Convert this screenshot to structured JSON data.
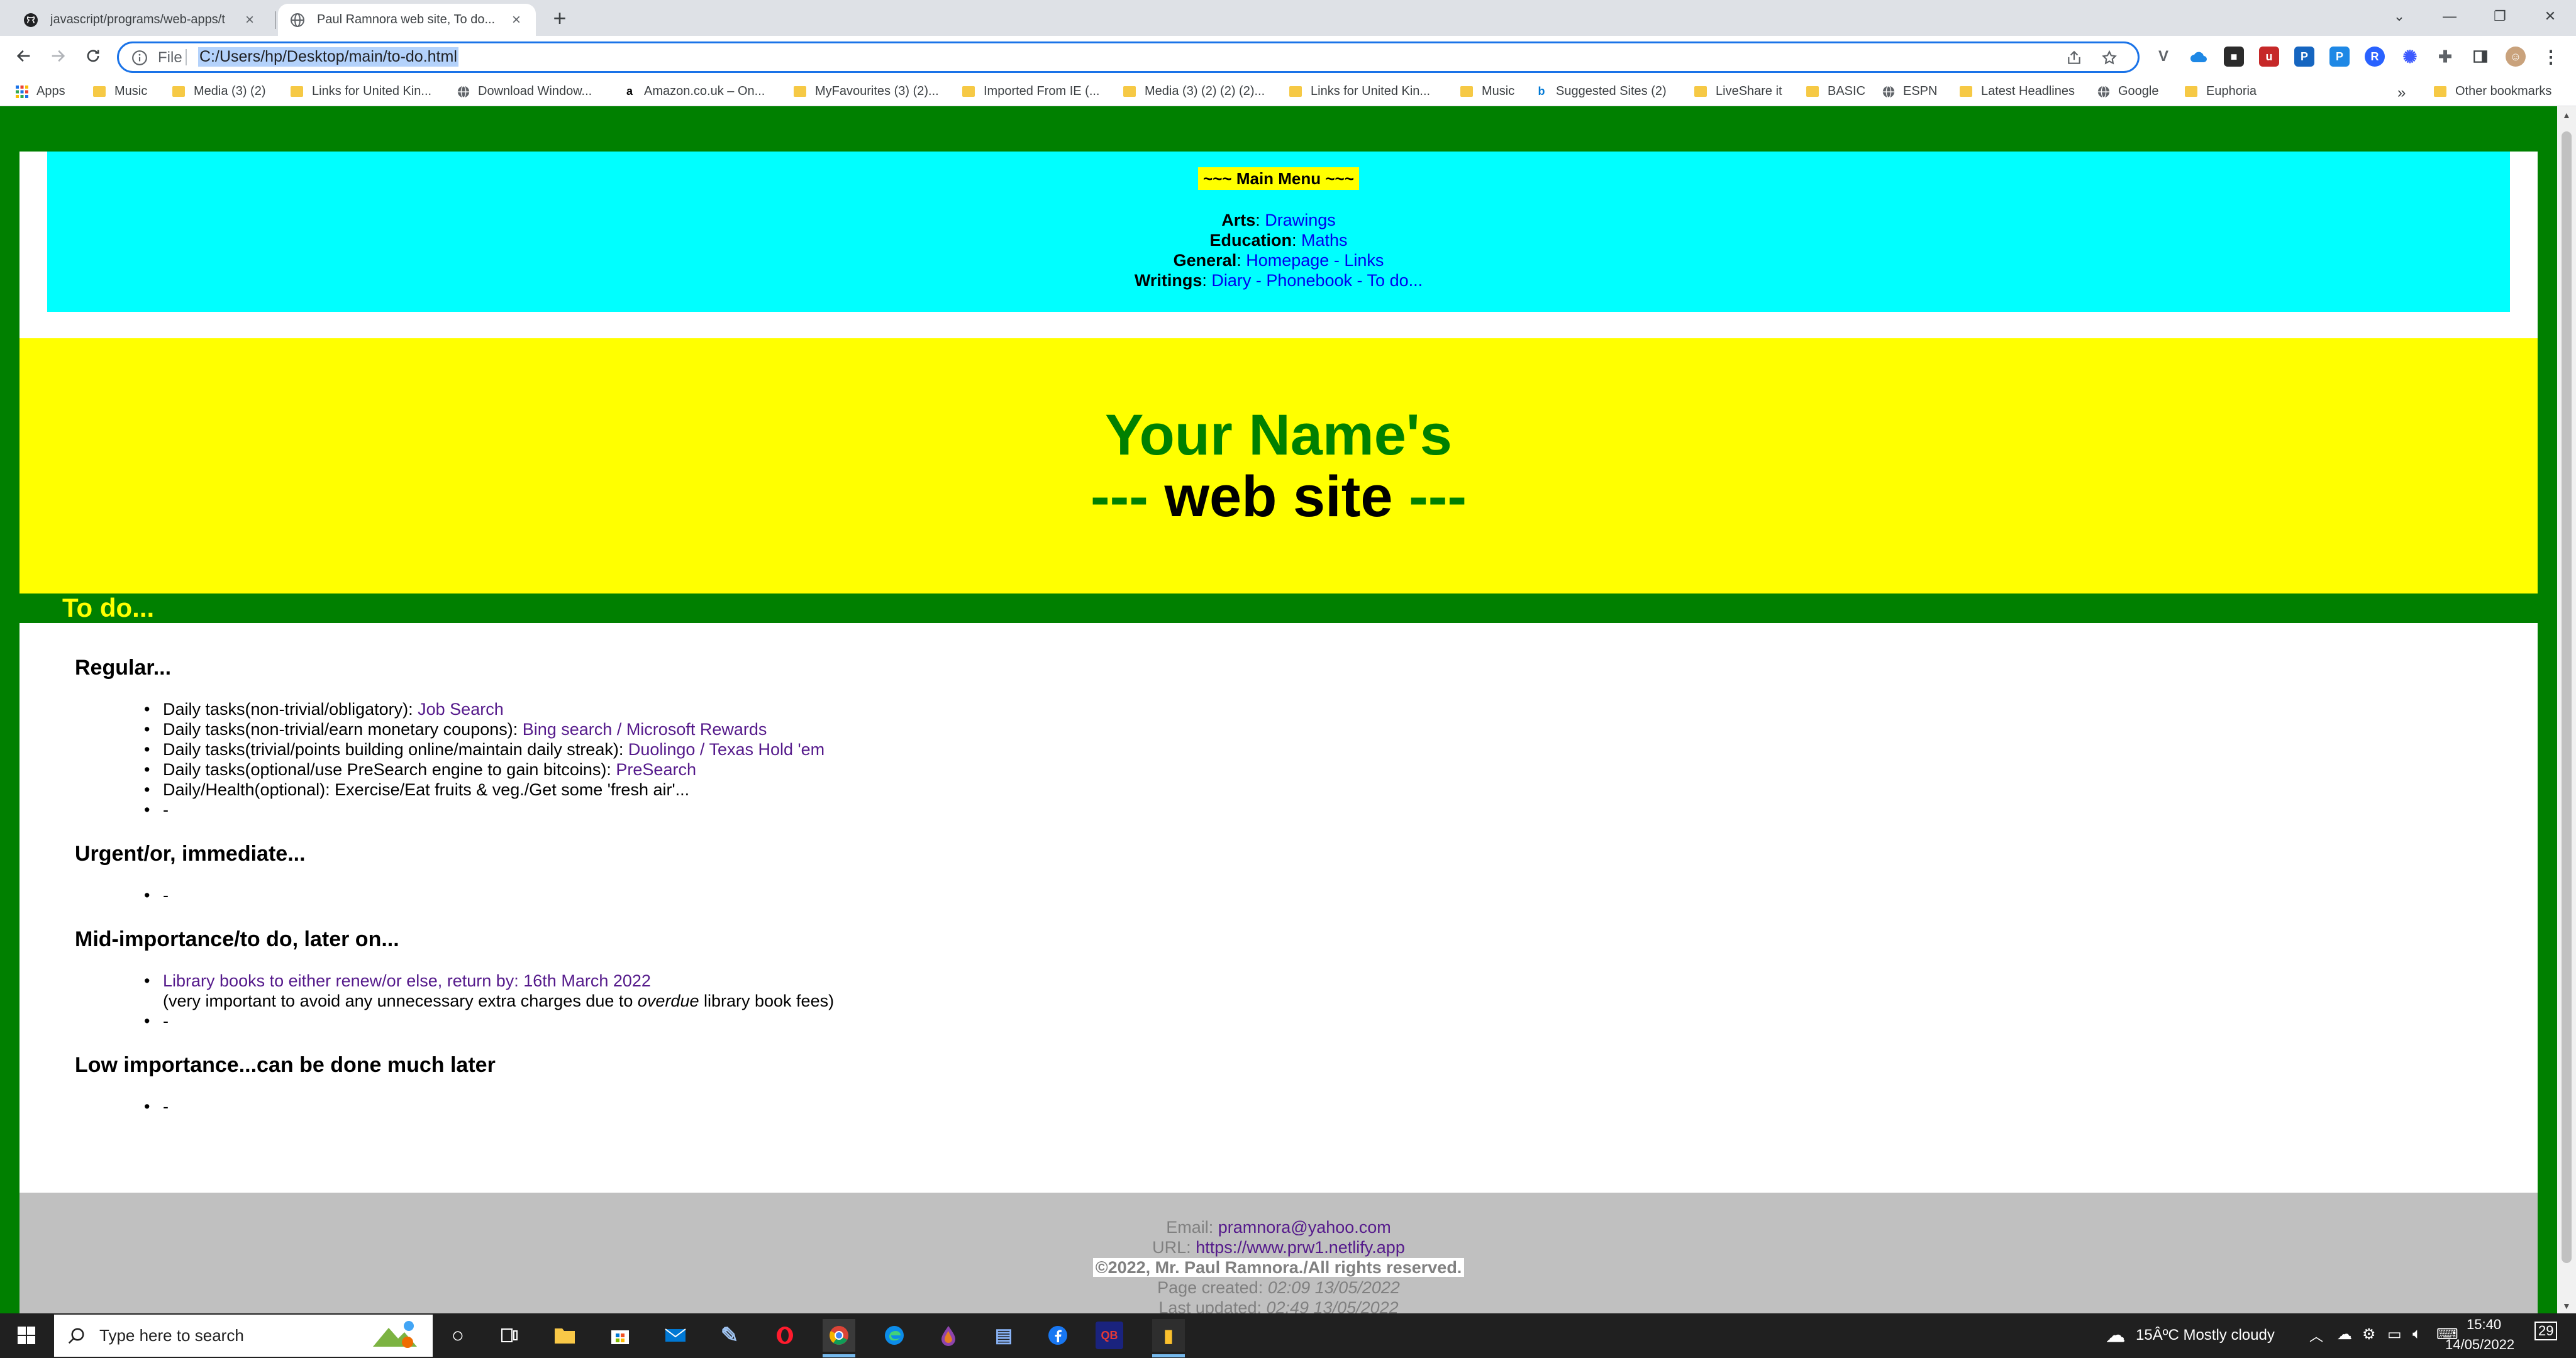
{
  "browser": {
    "tabs": [
      {
        "title": "javascript/programs/web-apps/t",
        "icon": "github-icon"
      },
      {
        "title": "Paul Ramnora web site, To do...",
        "icon": "globe-icon"
      }
    ],
    "address": {
      "scheme": "File",
      "url": "C:/Users/hp/Desktop/main/to-do.html"
    },
    "bookmarks": [
      {
        "label": "Apps",
        "icon": "apps-grid-icon"
      },
      {
        "label": "Music",
        "icon": "folder-icon"
      },
      {
        "label": "Media (3) (2)",
        "icon": "folder-icon"
      },
      {
        "label": "Links for United Kin...",
        "icon": "folder-icon"
      },
      {
        "label": "Download Window...",
        "icon": "globe-icon"
      },
      {
        "label": "Amazon.co.uk – On...",
        "icon": "amazon-icon"
      },
      {
        "label": "MyFavourites (3) (2)...",
        "icon": "folder-icon"
      },
      {
        "label": "Imported From IE (...",
        "icon": "folder-icon"
      },
      {
        "label": "Media (3) (2) (2) (2)...",
        "icon": "folder-icon"
      },
      {
        "label": "Links for United Kin...",
        "icon": "folder-icon"
      },
      {
        "label": "Music",
        "icon": "folder-icon"
      },
      {
        "label": "Suggested Sites (2)",
        "icon": "bing-icon"
      },
      {
        "label": "LiveShare it",
        "icon": "folder-icon"
      },
      {
        "label": "BASIC",
        "icon": "folder-icon"
      },
      {
        "label": "ESPN",
        "icon": "globe-icon"
      },
      {
        "label": "Latest Headlines",
        "icon": "folder-icon"
      },
      {
        "label": "Google",
        "icon": "globe-icon"
      },
      {
        "label": "Euphoria",
        "icon": "folder-icon"
      }
    ],
    "overflow": "»",
    "other_bookmarks": "Other bookmarks"
  },
  "menu": {
    "title": "~~~ Main Menu ~~~",
    "arts_label": "Arts",
    "arts_links": [
      "Drawings"
    ],
    "education_label": "Education",
    "education_links": [
      "Maths"
    ],
    "general_label": "General",
    "general_links": [
      "Homepage",
      "Links"
    ],
    "writings_label": "Writings",
    "writings_links": [
      "Diary",
      "Phonebook",
      "To do..."
    ],
    "separator": " - "
  },
  "banner": {
    "name": "Your Name's",
    "dash_left": "---",
    "site": "web site",
    "dash_right": "---"
  },
  "section_title": "To do...",
  "todo": {
    "regular": {
      "heading": "Regular...",
      "items": [
        {
          "text": "Daily tasks(non-trivial/obligatory): ",
          "link": "Job Search"
        },
        {
          "text": "Daily tasks(non-trivial/earn monetary coupons): ",
          "link": "Bing search / Microsoft Rewards"
        },
        {
          "text": "Daily tasks(trivial/points building online/maintain daily streak): ",
          "link": "Duolingo",
          "sep": " / ",
          "link2": "Texas Hold 'em"
        },
        {
          "text": "Daily tasks(optional/use PreSearch engine to gain bitcoins): ",
          "link": "PreSearch"
        },
        {
          "text": "Daily/Health(optional): Exercise/Eat fruits & veg./Get some 'fresh air'..."
        },
        {
          "text": "-"
        }
      ]
    },
    "urgent": {
      "heading": "Urgent/or, immediate...",
      "items": [
        "-"
      ]
    },
    "mid": {
      "heading": "Mid-importance/to do, later on...",
      "library_link": "Library books to either renew/or else, return by: 16th March 2022",
      "library_note_a": "(very important to avoid any unnecessary extra charges due to ",
      "library_note_em": "overdue",
      "library_note_b": " library book fees)",
      "dash": "-"
    },
    "low": {
      "heading": "Low importance...can be done much later",
      "items": [
        "-"
      ]
    }
  },
  "footer": {
    "email_label": "Email: ",
    "email": "pramnora@yahoo.com",
    "url_label": "URL: ",
    "url": "https://www.prw1.netlify.app",
    "copyright": "©2022, Mr. Paul Ramnora./All rights reserved.",
    "created_label": "Page created: ",
    "created": "02:09 13/05/2022",
    "updated_label": "Last updated: ",
    "updated": "02:49 13/05/2022"
  },
  "taskbar": {
    "search_placeholder": "Type here to search",
    "weather": "15ÂºC  Mostly cloudy",
    "time": "15:40",
    "date": "14/05/2022",
    "notifications": "29"
  },
  "colors": {
    "page_bg": "#008000",
    "menu_bg": "#00ffff",
    "banner_bg": "#ffff00",
    "section_title": "#ffff00",
    "footer_bg": "#c0c0c0",
    "link": "#0000ee",
    "visited": "#551a8b"
  }
}
